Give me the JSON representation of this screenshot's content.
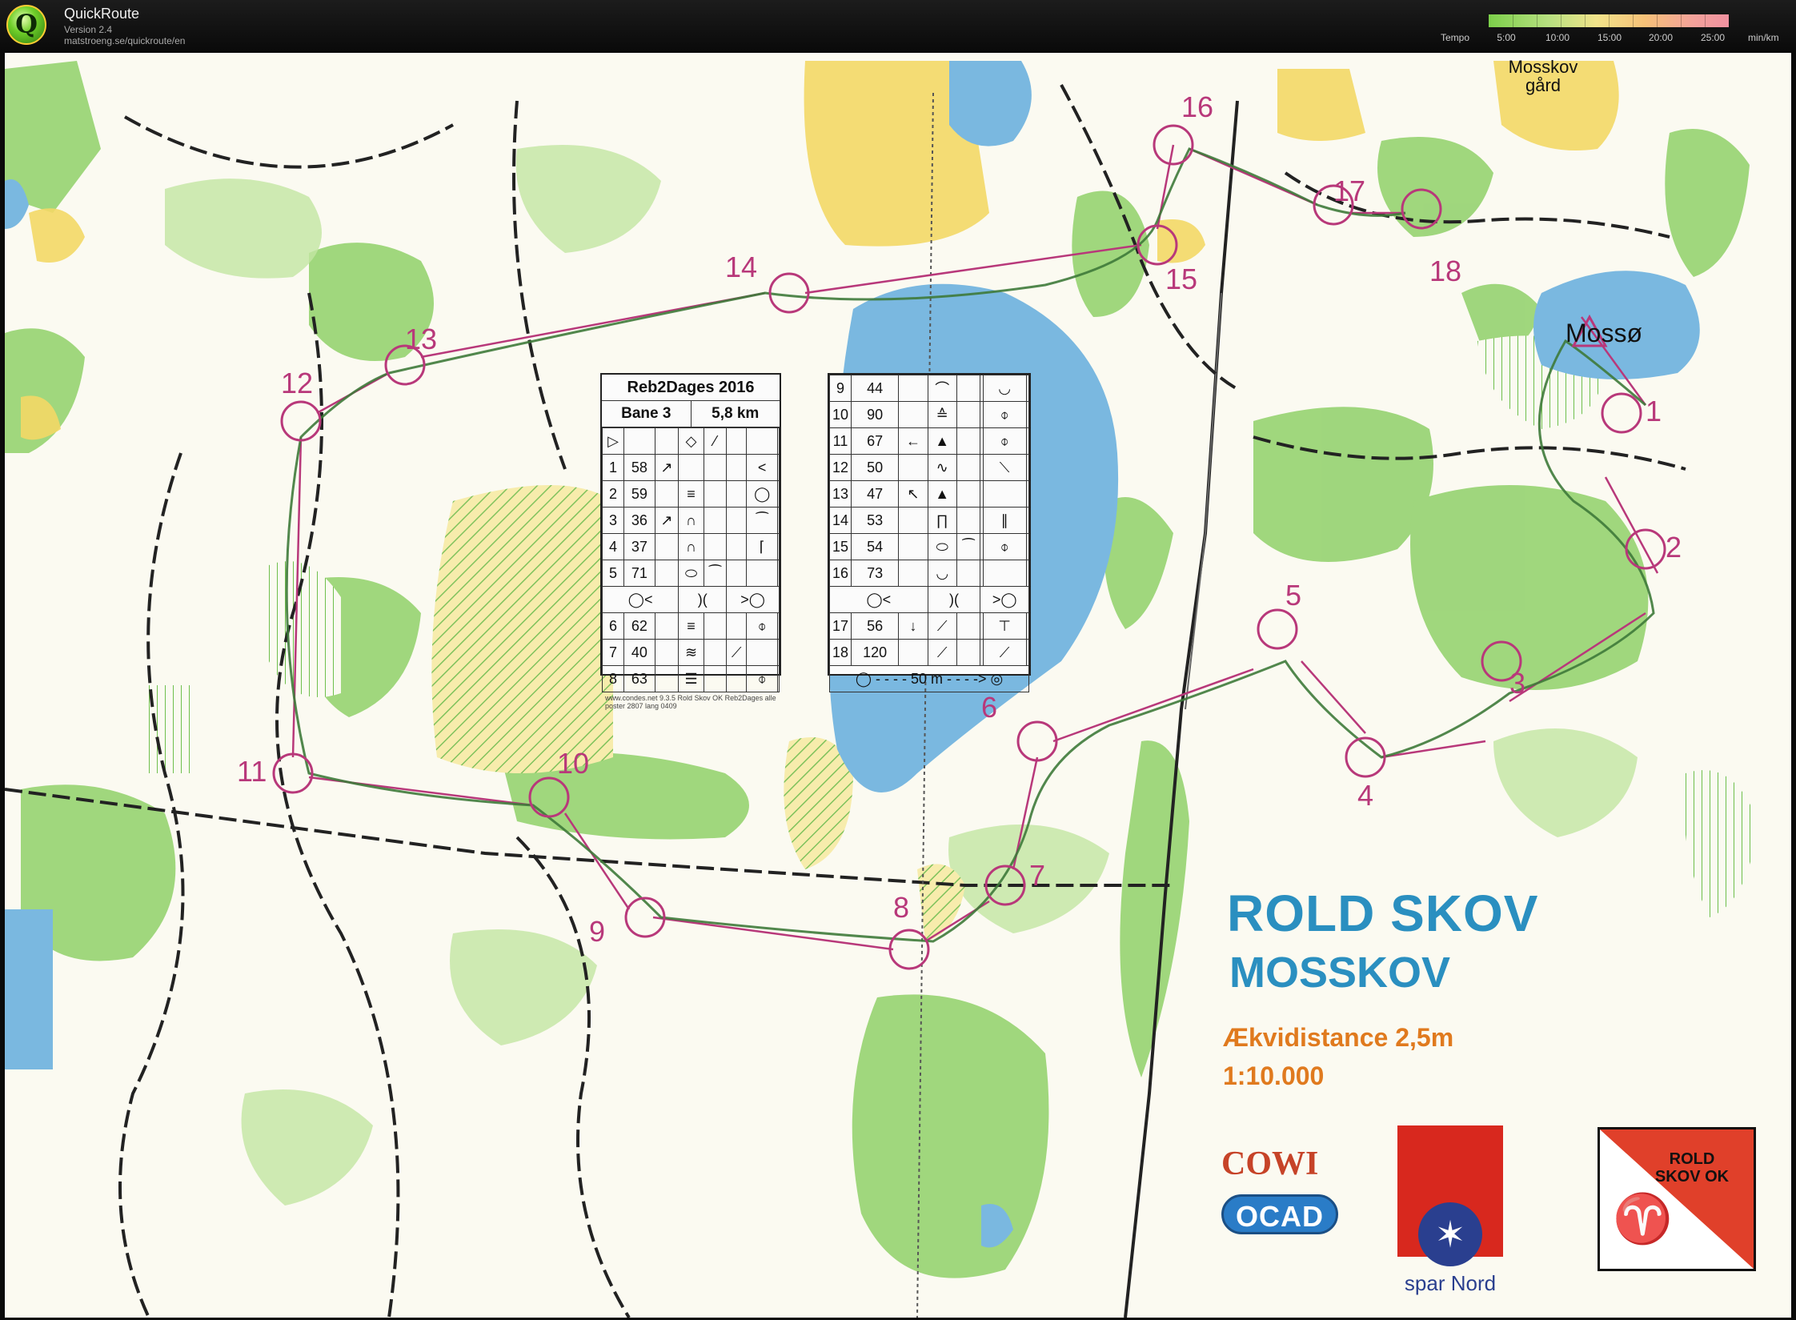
{
  "app": {
    "name": "QuickRoute",
    "version": "Version 2.4",
    "url": "matstroeng.se/quickroute/en",
    "logo_letter": "Q"
  },
  "tempo": {
    "label": "Tempo",
    "ticks": [
      "5:00",
      "10:00",
      "15:00",
      "20:00",
      "25:00"
    ],
    "unit": "min/km"
  },
  "map": {
    "title": "ROLD SKOV",
    "subtitle": "MOSSKOV",
    "contour_interval": "Ækvidistance 2,5m",
    "scale": "1:10.000",
    "places": {
      "farm": "Mosskov gård",
      "lake": "Mossø"
    },
    "controls": [
      "1",
      "2",
      "3",
      "4",
      "5",
      "6",
      "7",
      "8",
      "9",
      "10",
      "11",
      "12",
      "13",
      "14",
      "15",
      "16",
      "17",
      "18"
    ]
  },
  "description_sheet": {
    "event": "Reb2Dages 2016",
    "course": "Bane 3",
    "length": "5,8 km",
    "left_rows": [
      {
        "n": "1",
        "code": "58"
      },
      {
        "n": "2",
        "code": "59"
      },
      {
        "n": "3",
        "code": "36"
      },
      {
        "n": "4",
        "code": "37"
      },
      {
        "n": "5",
        "code": "71"
      },
      {
        "n": "6",
        "code": "62"
      },
      {
        "n": "7",
        "code": "40"
      },
      {
        "n": "8",
        "code": "63"
      }
    ],
    "right_rows": [
      {
        "n": "9",
        "code": "44"
      },
      {
        "n": "10",
        "code": "90"
      },
      {
        "n": "11",
        "code": "67"
      },
      {
        "n": "12",
        "code": "50"
      },
      {
        "n": "13",
        "code": "47"
      },
      {
        "n": "14",
        "code": "53"
      },
      {
        "n": "15",
        "code": "54"
      },
      {
        "n": "16",
        "code": "73"
      },
      {
        "n": "17",
        "code": "56"
      },
      {
        "n": "18",
        "code": "120"
      }
    ],
    "finish_distance": "50 m",
    "footer": "www.condes.net 9.3.5 Rold Skov OK  Reb2Dages alle poster  2807 lang 0409"
  },
  "sponsors": {
    "cowi": "COWI",
    "ocad": "OCAD",
    "spar_nord": "spar Nord",
    "club": "ROLD SKOV OK"
  },
  "colors": {
    "course": "#b8387a",
    "forest_green": "#7cc55a",
    "open_yellow": "#f3d866",
    "water_blue": "#7ab8e0",
    "title_blue": "#2a8fc0",
    "info_orange": "#e07a1e"
  }
}
